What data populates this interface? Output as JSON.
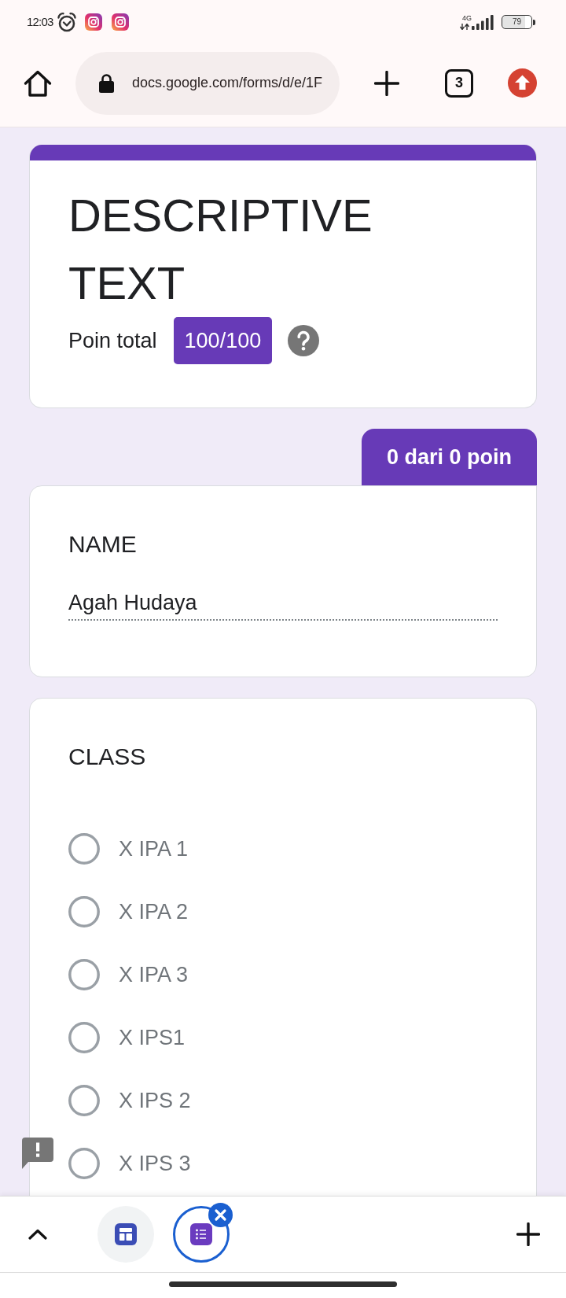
{
  "status_bar": {
    "time": "12:03",
    "network": "4G",
    "battery": "79"
  },
  "browser_toolbar": {
    "url": "docs.google.com/forms/d/e/1F",
    "tab_count": "3"
  },
  "form": {
    "title": "DESCRIPTIVE TEXT",
    "points_label": "Poin total",
    "points_badge": "100/100"
  },
  "questions": [
    {
      "kind": "text",
      "score": "0 dari 0 poin",
      "title": "NAME",
      "value": "Agah Hudaya"
    },
    {
      "kind": "radio",
      "title": "CLASS",
      "options": [
        {
          "label": "X IPA 1",
          "selected": false
        },
        {
          "label": "X IPA 2",
          "selected": false
        },
        {
          "label": "X IPA 3",
          "selected": false
        },
        {
          "label": "X IPS1",
          "selected": false
        },
        {
          "label": "X IPS 2",
          "selected": false
        },
        {
          "label": "X IPS 3",
          "selected": false
        }
      ]
    }
  ],
  "bottom_bar": {
    "tabs": [
      {
        "selected": false
      },
      {
        "selected": true
      }
    ]
  }
}
